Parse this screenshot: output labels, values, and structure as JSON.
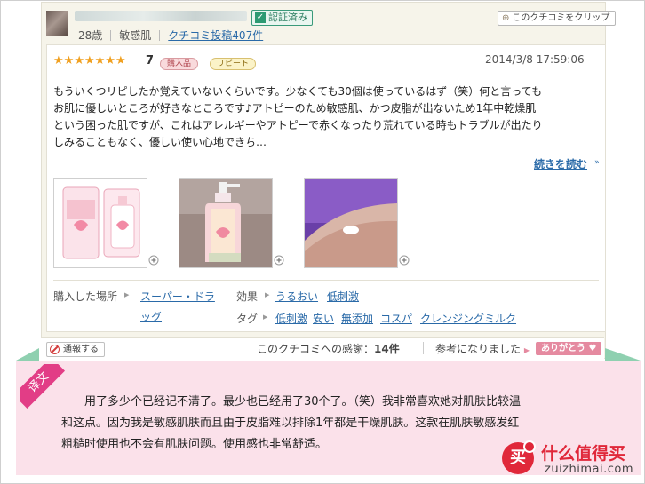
{
  "reviewer": {
    "verified_label": "認証済み",
    "age": "28歳",
    "skin_type": "敏感肌",
    "review_count_label": "クチコミ投稿407件",
    "clip_label": "このクチコミをクリップ"
  },
  "review": {
    "stars": 7,
    "rating": "7",
    "badges": [
      "購入品",
      "リピート"
    ],
    "datetime": "2014/3/8 17:59:06",
    "body_lines": [
      "もういくつリピしたか覚えていないくらいです。少なくても30個は使っているはず（笑）何と言っても",
      "お肌に優しいところが好きなところです♪アトピーのため敏感肌、かつ皮脂が出ないため1年中乾燥肌",
      "という困った肌ですが、これはアレルギーやアトピーで赤くなったり荒れている時もトラブルが出たり",
      "しみることもなく、優しい使い心地できち…"
    ],
    "read_more": "続きを読む"
  },
  "details": {
    "purchase_place_label": "購入した場所",
    "purchase_place_value_1": "スーパー・ドラ",
    "purchase_place_value_2": "ッグ",
    "effect_label": "効果",
    "effects": [
      "うるおい",
      "低刺激"
    ],
    "tag_label": "タグ",
    "tags": [
      "低刺激",
      "安い",
      "無添加",
      "コスパ",
      "クレンジングミルク"
    ]
  },
  "footer": {
    "report_label": "通報する",
    "thanks_text": "このクチコミへの感謝：",
    "thanks_count": "14件",
    "helpful_label": "参考になりました",
    "arigato_label": "ありがとう"
  },
  "translation": {
    "ribbon_label": "译文",
    "lines": [
      "用了多少个已经记不清了。最少也已经用了30个了。（笑）我非常喜欢她对肌肤比较温",
      "和这点。因为我是敏感肌肤而且由于皮脂难以排除1年都是干燥肌肤。这款在肌肤敏感发红",
      "粗糙时使用也不会有肌肤问题。使用感也非常舒适。"
    ]
  },
  "watermark": {
    "brand": "什么值得买",
    "url": "zuizhimai.com",
    "logo_char": "买"
  }
}
